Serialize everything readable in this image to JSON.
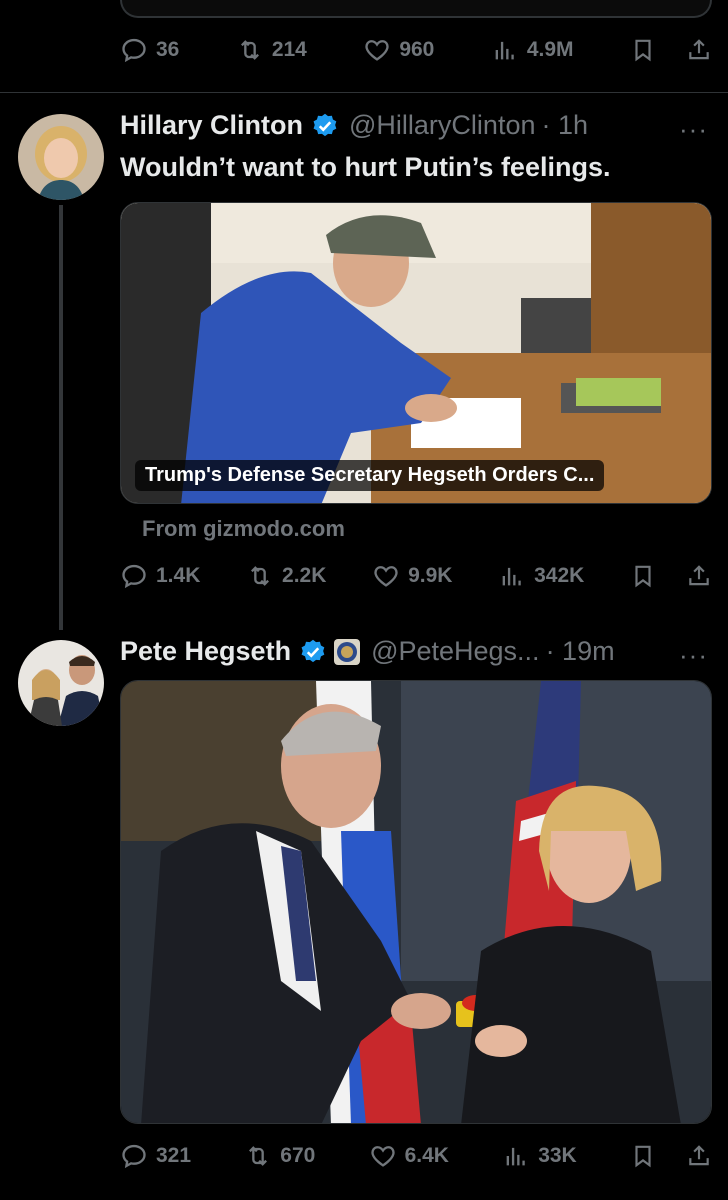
{
  "tweet0": {
    "replies": "36",
    "reposts": "214",
    "likes": "960",
    "views": "4.9M"
  },
  "tweet1": {
    "name": "Hillary Clinton",
    "handle": "@HillaryClinton",
    "time": "· 1h",
    "text": "Wouldn’t want to hurt Putin’s feelings.",
    "card_title": "Trump's Defense Secretary Hegseth Orders C...",
    "card_source": "From gizmodo.com",
    "replies": "1.4K",
    "reposts": "2.2K",
    "likes": "9.9K",
    "views": "342K"
  },
  "tweet2": {
    "name": "Pete Hegseth",
    "handle": "@PeteHegs...",
    "time": "· 19m",
    "replies": "321",
    "reposts": "670",
    "likes": "6.4K",
    "views": "33K"
  },
  "icons": {
    "reply": "reply-icon",
    "repost": "repost-icon",
    "like": "like-icon",
    "views": "views-icon",
    "bookmark": "bookmark-icon",
    "share": "share-icon",
    "verified": "verified-badge-icon",
    "more": "more-icon"
  },
  "more_label": "···",
  "colors": {
    "background": "#000000",
    "text": "#e7e9ea",
    "muted": "#71767b",
    "verified": "#1d9bf0",
    "divider": "#2f3336"
  }
}
